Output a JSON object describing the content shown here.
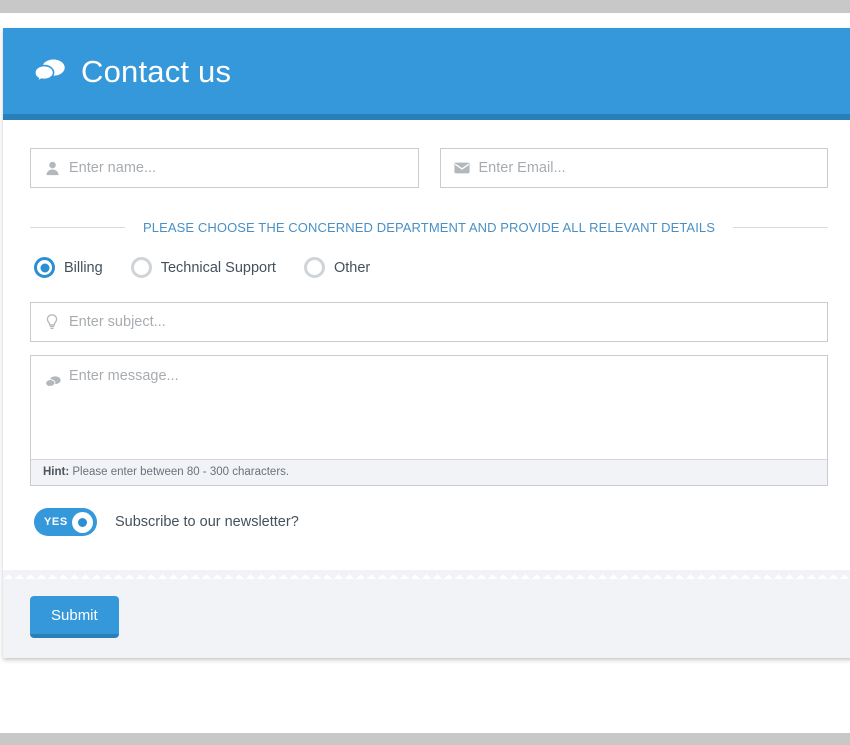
{
  "header": {
    "title": "Contact us",
    "icon": "speech-bubbles-icon"
  },
  "form": {
    "name_field": {
      "placeholder": "Enter name...",
      "value": "",
      "icon": "user-icon"
    },
    "email_field": {
      "placeholder": "Enter Email...",
      "value": "",
      "icon": "envelope-icon"
    },
    "divider_text": "PLEASE CHOOSE THE CONCERNED DEPARTMENT AND PROVIDE ALL RELEVANT DETAILS",
    "department_options": [
      {
        "label": "Billing",
        "selected": true
      },
      {
        "label": "Technical Support",
        "selected": false
      },
      {
        "label": "Other",
        "selected": false
      }
    ],
    "subject_field": {
      "placeholder": "Enter subject...",
      "value": "",
      "icon": "lightbulb-icon"
    },
    "message_field": {
      "placeholder": "Enter message...",
      "value": "",
      "icon": "speech-bubbles-icon"
    },
    "hint": {
      "label": "Hint:",
      "text": " Please enter between 80 - 300 characters."
    },
    "newsletter_toggle": {
      "state_text": "YES",
      "on": true,
      "label": "Subscribe to our newsletter?"
    },
    "submit_label": "Submit"
  },
  "colors": {
    "brand_blue": "#3498db",
    "brand_blue_dark": "#2980b9",
    "divider_text_blue": "#4a90c4",
    "footer_grey": "#f1f3f7",
    "page_band_grey": "#c8c8c8"
  }
}
